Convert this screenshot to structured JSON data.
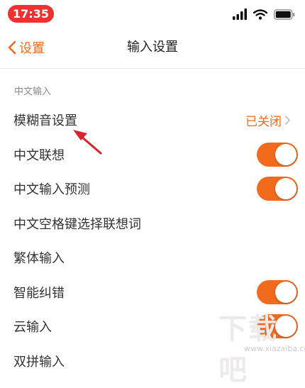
{
  "status_bar": {
    "time": "17:35"
  },
  "nav": {
    "back_label": "设置",
    "title": "输入设置"
  },
  "section": {
    "header": "中文输入"
  },
  "rows": [
    {
      "label": "模糊音设置",
      "value": "已关闭"
    },
    {
      "label": "中文联想",
      "toggle": true
    },
    {
      "label": "中文输入预测",
      "toggle": true
    },
    {
      "label": "中文空格键选择联想词",
      "toggle": false
    },
    {
      "label": "繁体输入",
      "toggle": false
    },
    {
      "label": "智能纠错",
      "toggle": true
    },
    {
      "label": "云输入",
      "toggle": true
    },
    {
      "label": "双拼输入"
    }
  ],
  "watermark": {
    "text": "下载吧",
    "url": "www.xiazaiba.com"
  },
  "colors": {
    "accent": "#f26a1b",
    "time_pill": "#f2302f",
    "annotation_arrow": "#d9232e"
  },
  "icons": [
    "signal-bars-icon",
    "wifi-icon",
    "battery-icon",
    "chevron-left-icon",
    "chevron-right-icon",
    "annotation-arrow-icon"
  ]
}
